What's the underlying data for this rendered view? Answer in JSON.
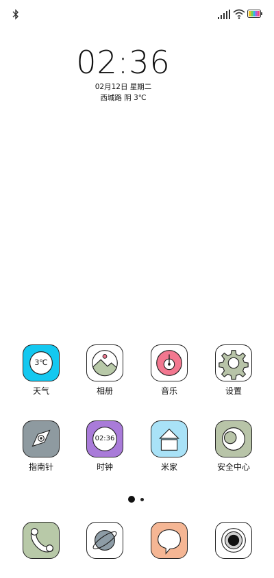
{
  "status_bar": {
    "bluetooth_icon": "bluetooth-icon",
    "signal_icon": "signal-icon",
    "wifi_icon": "wifi-icon",
    "battery_icon": "battery-icon"
  },
  "clock": {
    "time": "02:36",
    "date": "02月12日 星期二",
    "weather": "西城路 阴 3℃"
  },
  "apps": [
    {
      "label": "天气",
      "icon": "weather-icon",
      "icon_text": "3℃",
      "color": "#14c8f0"
    },
    {
      "label": "相册",
      "icon": "gallery-icon",
      "color": "#b8c9a8"
    },
    {
      "label": "音乐",
      "icon": "music-icon",
      "color": "#f2778f"
    },
    {
      "label": "设置",
      "icon": "settings-icon",
      "color": "#b8c4a8"
    },
    {
      "label": "指南针",
      "icon": "compass-icon",
      "color": "#8e9aa0"
    },
    {
      "label": "时钟",
      "icon": "clock-icon",
      "icon_text": "02:36",
      "color": "#a97bd9"
    },
    {
      "label": "米家",
      "icon": "home-icon",
      "color": "#a9e2f7"
    },
    {
      "label": "安全中心",
      "icon": "security-icon",
      "color": "#b8c4a8"
    }
  ],
  "dock": [
    {
      "icon": "phone-icon",
      "color": "#b8c9a8"
    },
    {
      "icon": "browser-icon",
      "color": "#8d9ca6"
    },
    {
      "icon": "messages-icon",
      "color": "#f5b694"
    },
    {
      "icon": "camera-icon",
      "color": "#cfcfcf"
    }
  ],
  "pagination": {
    "pages": 2,
    "current": 1
  }
}
